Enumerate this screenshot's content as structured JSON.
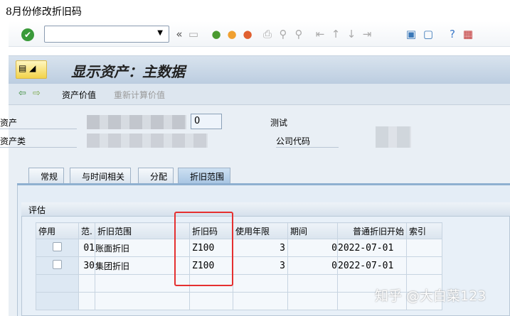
{
  "caption": "8月份修改折旧码",
  "toolbar": {
    "command_value": "",
    "icons": [
      "enter-check",
      "back",
      "save",
      "back-green",
      "exit",
      "cancel",
      "print",
      "find",
      "find-next",
      "first-page",
      "prev-page",
      "next-page",
      "last-page",
      "new-session",
      "shortcut",
      "help",
      "customize"
    ]
  },
  "title": "显示资产：主数据",
  "app_toolbar": {
    "asset_values": "资产价值",
    "recalc_values": "重新计算价值"
  },
  "header": {
    "asset_label": "资产",
    "sub_number": "0",
    "description": "测试",
    "asset_class_label": "资产类",
    "company_code_label": "公司代码"
  },
  "tabs": [
    {
      "label": "常规"
    },
    {
      "label": "与时间相关"
    },
    {
      "label": "分配"
    },
    {
      "label": "折旧范围",
      "active": true
    }
  ],
  "group_title": "评估",
  "table": {
    "columns": [
      "停用",
      "范.",
      "折旧范围",
      "折旧码",
      "使用年限",
      "期间",
      "普通折旧开始",
      "索引"
    ],
    "rows": [
      {
        "deactivated": false,
        "area": "01",
        "area_name": "账面折旧",
        "key": "Z100",
        "years": "3",
        "periods": "0",
        "start": "2022-07-01",
        "index": ""
      },
      {
        "deactivated": false,
        "area": "30",
        "area_name": "集团折旧",
        "key": "Z100",
        "years": "3",
        "periods": "0",
        "start": "2022-07-01",
        "index": ""
      }
    ]
  },
  "watermark": "知乎 @大白菜123",
  "colors": {
    "highlight": "#e53030",
    "title_bar": "#c8d7e6"
  }
}
